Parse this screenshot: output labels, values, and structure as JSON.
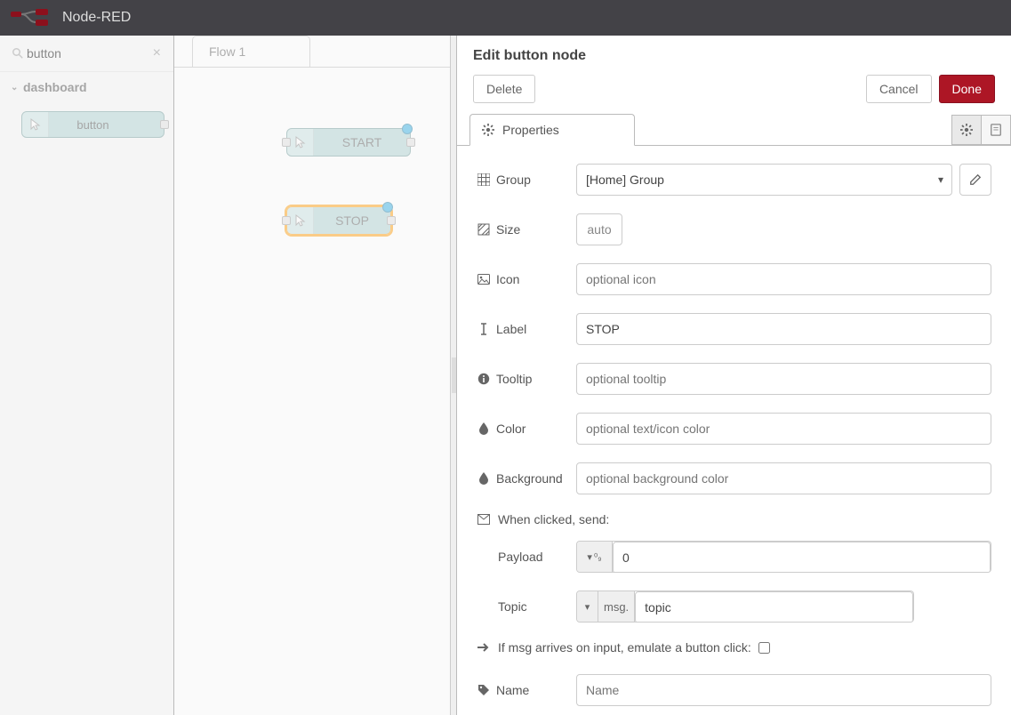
{
  "header": {
    "title": "Node-RED"
  },
  "palette": {
    "search_value": "button",
    "category": "dashboard",
    "node_label": "button"
  },
  "workspace": {
    "tab_label": "Flow 1",
    "nodes": {
      "start": {
        "label": "START"
      },
      "stop": {
        "label": "STOP"
      }
    }
  },
  "editor": {
    "title": "Edit button node",
    "buttons": {
      "delete": "Delete",
      "cancel": "Cancel",
      "done": "Done"
    },
    "prop_tab": "Properties",
    "fields": {
      "group_label": "Group",
      "group_value": "[Home] Group",
      "size_label": "Size",
      "size_value": "auto",
      "icon_label": "Icon",
      "icon_placeholder": "optional icon",
      "label_label": "Label",
      "label_value": "STOP",
      "tooltip_label": "Tooltip",
      "tooltip_placeholder": "optional tooltip",
      "color_label": "Color",
      "color_placeholder": "optional text/icon color",
      "bg_label": "Background",
      "bg_placeholder": "optional background color",
      "when_clicked": "When clicked, send:",
      "payload_label": "Payload",
      "payload_type_glyph": "⁰₉",
      "payload_value": "0",
      "topic_label": "Topic",
      "topic_prefix": "msg.",
      "topic_value": "topic",
      "emulate_label": "If msg arrives on input, emulate a button click:",
      "name_label": "Name",
      "name_placeholder": "Name"
    }
  }
}
